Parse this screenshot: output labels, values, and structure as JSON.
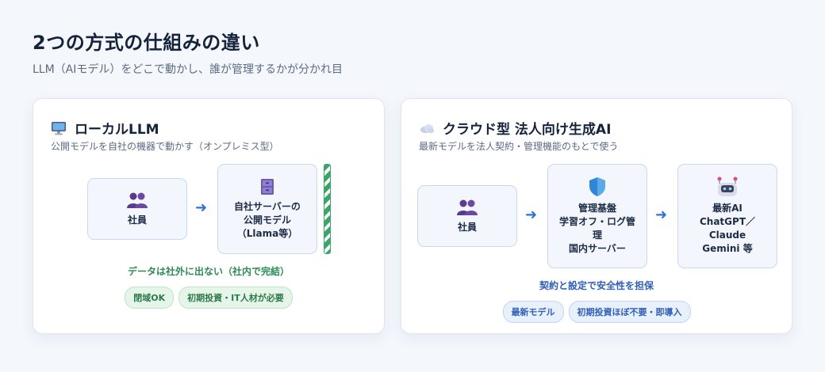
{
  "header": {
    "title": "2つの方式の仕組みの違い",
    "subtitle": "LLM（AIモデル）をどこで動かし、誰が管理するかが分かれ目"
  },
  "local": {
    "title": "ローカルLLM",
    "icon": "desktop-computer-icon",
    "description": "公開モデルを自社の機器で動かす（オンプレミス型）",
    "box_employee": "社員",
    "box_server_line1": "自社サーバーの",
    "box_server_line2": "公開モデル",
    "box_server_line3": "（Llama等）",
    "note": "データは社外に出ない（社内で完結）",
    "pill_1": "閉域OK",
    "pill_2": "初期投資・IT人材が必要"
  },
  "cloud": {
    "title": "クラウド型 法人向け生成AI",
    "icon": "cloud-icon",
    "description": "最新モデルを法人契約・管理機能のもとで使う",
    "box_employee": "社員",
    "box_platform_line1": "管理基盤",
    "box_platform_line2": "学習オフ・ログ管",
    "box_platform_line3": "理",
    "box_platform_line4": "国内サーバー",
    "box_ai_line1": "最新AI",
    "box_ai_line2": "ChatGPT／",
    "box_ai_line3": "Claude",
    "box_ai_line4": "Gemini 等",
    "note": "契約と設定で安全性を担保",
    "pill_1": "最新モデル",
    "pill_2": "初期投資ほぼ不要・即導入"
  },
  "colors": {
    "accent_blue": "#2f6fd8",
    "accent_green": "#2e8a55",
    "box_fill": "#f3f7fd",
    "box_border": "#c9d8ee"
  }
}
